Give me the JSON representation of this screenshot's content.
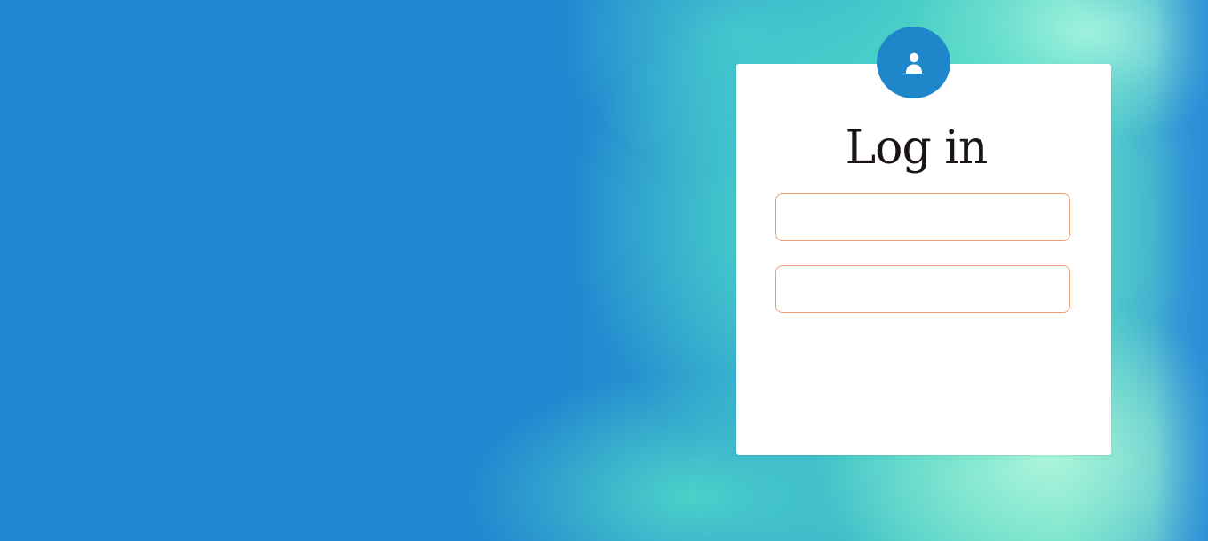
{
  "login": {
    "title": "Log in",
    "avatar_icon": "user-icon",
    "username": {
      "value": "",
      "placeholder": ""
    },
    "password": {
      "value": "",
      "placeholder": ""
    }
  },
  "colors": {
    "background_blue": "#2086d0",
    "background_teal": "#5ed8c6",
    "avatar_circle": "#1f86c9",
    "input_border": "#f29a78",
    "title_text": "#1b1416"
  }
}
